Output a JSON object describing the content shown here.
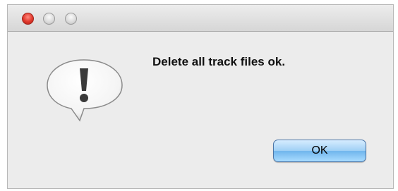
{
  "window": {
    "controls": {
      "close_icon": "close-icon",
      "minimize_icon": "minimize-icon",
      "zoom_icon": "zoom-icon"
    }
  },
  "dialog": {
    "icon": "alert-caution-icon",
    "message": "Delete all track files ok.",
    "ok_label": "OK"
  },
  "colors": {
    "close": "#e0372b",
    "button_accent": "#6fb5ec",
    "background": "#ececec"
  }
}
